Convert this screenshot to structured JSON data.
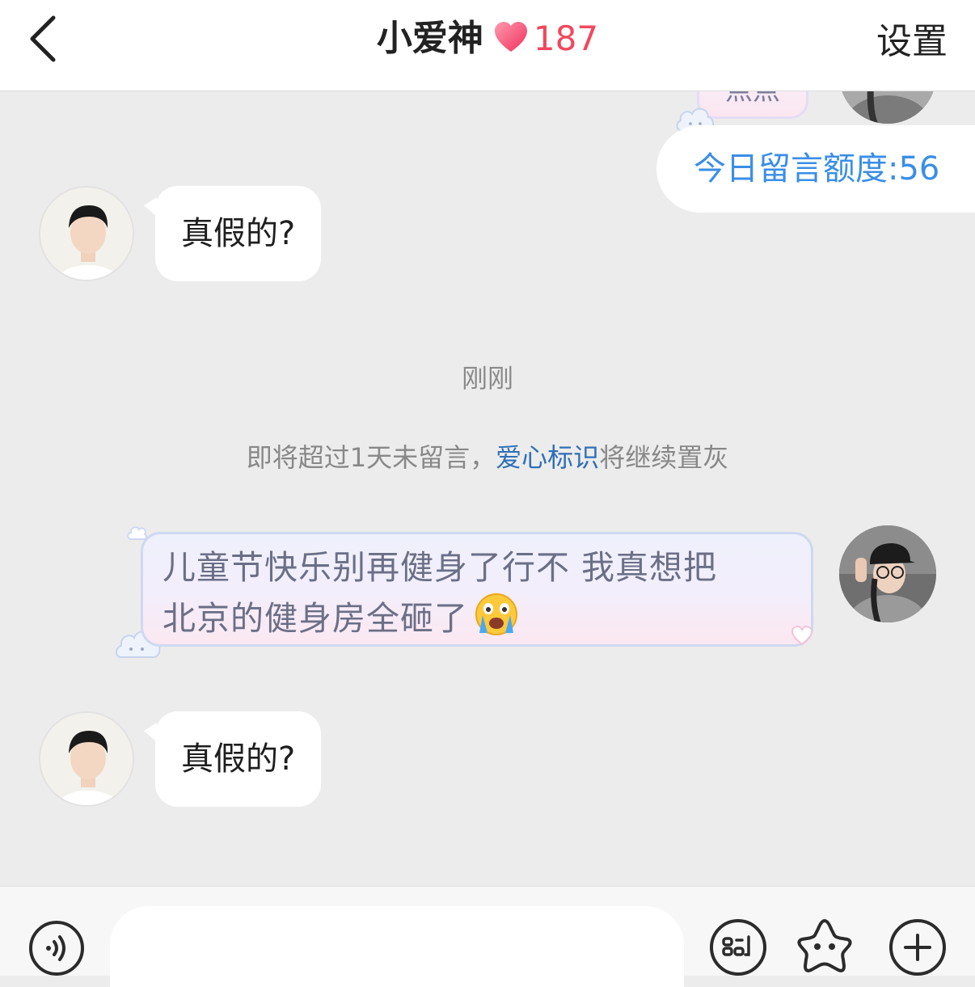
{
  "header": {
    "title": "小爱神",
    "heart_count": "187",
    "settings_label": "设置"
  },
  "chat": {
    "partial_bubble_text": "点点",
    "quota_label": "今日留言额度:56",
    "messages": [
      {
        "from": "other",
        "text": "真假的?"
      },
      {
        "from": "other",
        "text": "真假的?"
      }
    ],
    "time_label": "刚刚",
    "notice": {
      "prefix": "即将超过1天未留言，",
      "link": "爱心标识",
      "suffix": "将继续置灰"
    },
    "self_message": {
      "line1": "儿童节快乐别再健身了行不 我真想把",
      "line2": "北京的健身房全砸了"
    }
  },
  "colors": {
    "accent_red": "#f2475d",
    "link_blue": "#2f6fb6",
    "quota_blue": "#3a8ee6"
  },
  "bottom_bar": {
    "icons": [
      "voice-icon",
      "keyboard-shortcut-icon",
      "sticker-star-icon",
      "plus-icon"
    ]
  }
}
